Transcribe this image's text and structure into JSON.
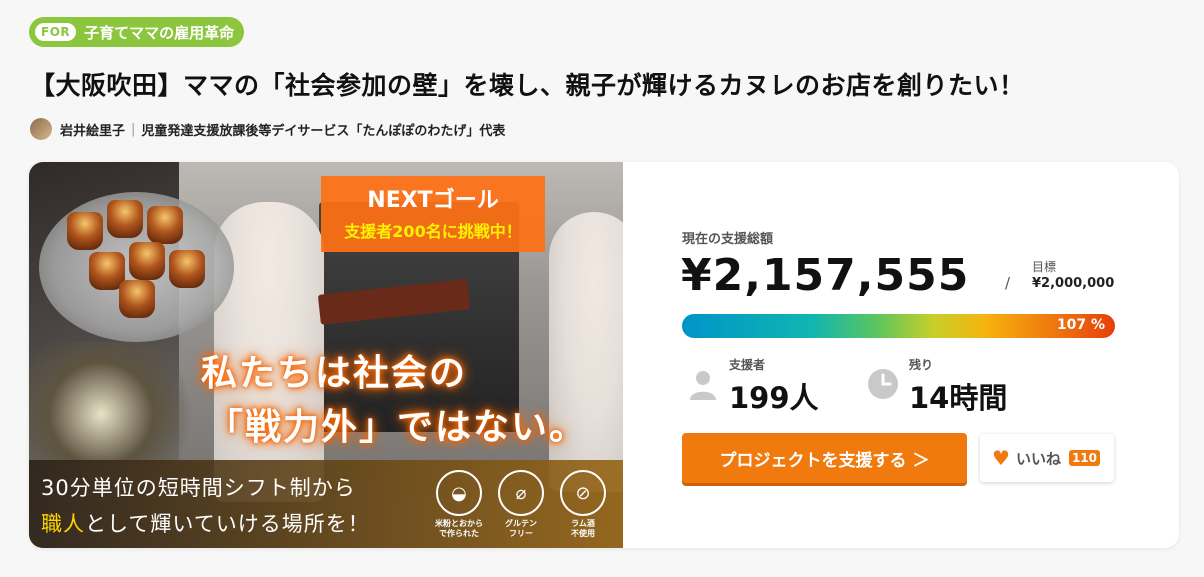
{
  "tag": {
    "prefix": "FOR",
    "label": "子育てママの雇用革命"
  },
  "project": {
    "title": "【大阪吹田】ママの「社会参加の壁」を壊し、親子が輝けるカヌレのお店を創りたい！",
    "author_name": "岩井絵里子",
    "author_role": "児童発達支援放課後等デイサービス「たんぽぽのわたげ」代表"
  },
  "hero": {
    "next_goal_title": "NEXTゴール",
    "next_goal_text": "支援者200名に挑戦中！",
    "catch_line1": "私たちは社会の",
    "catch_line2": "「戦力外」ではない。",
    "band_line1": "30分単位の短時間シフト制から",
    "band_line2_highlight": "職人",
    "band_line2_rest": "として輝いていける場所を！",
    "badges": [
      {
        "icon": "rice-bowl-icon",
        "caption": "米粉とおから\nで作られた"
      },
      {
        "icon": "wheat-icon",
        "caption": "グルテン\nフリー"
      },
      {
        "icon": "bottle-icon",
        "caption": "ラム酒\n不使用"
      }
    ]
  },
  "funding": {
    "total_label": "現在の支援総額",
    "total_amount": "¥2,157,555",
    "slash": "/",
    "goal_label": "目標",
    "goal_amount": "¥2,000,000",
    "progress_percent": 107,
    "progress_text": "107 %",
    "supporters_label": "支援者",
    "supporters_value": "199人",
    "remaining_label": "残り",
    "remaining_value": "14時間"
  },
  "actions": {
    "support_button": "プロジェクトを支援する ＞",
    "like_label": "いいね",
    "like_count": "110"
  },
  "colors": {
    "accent": "#f07a0e",
    "tag_green": "#8cc63f"
  }
}
